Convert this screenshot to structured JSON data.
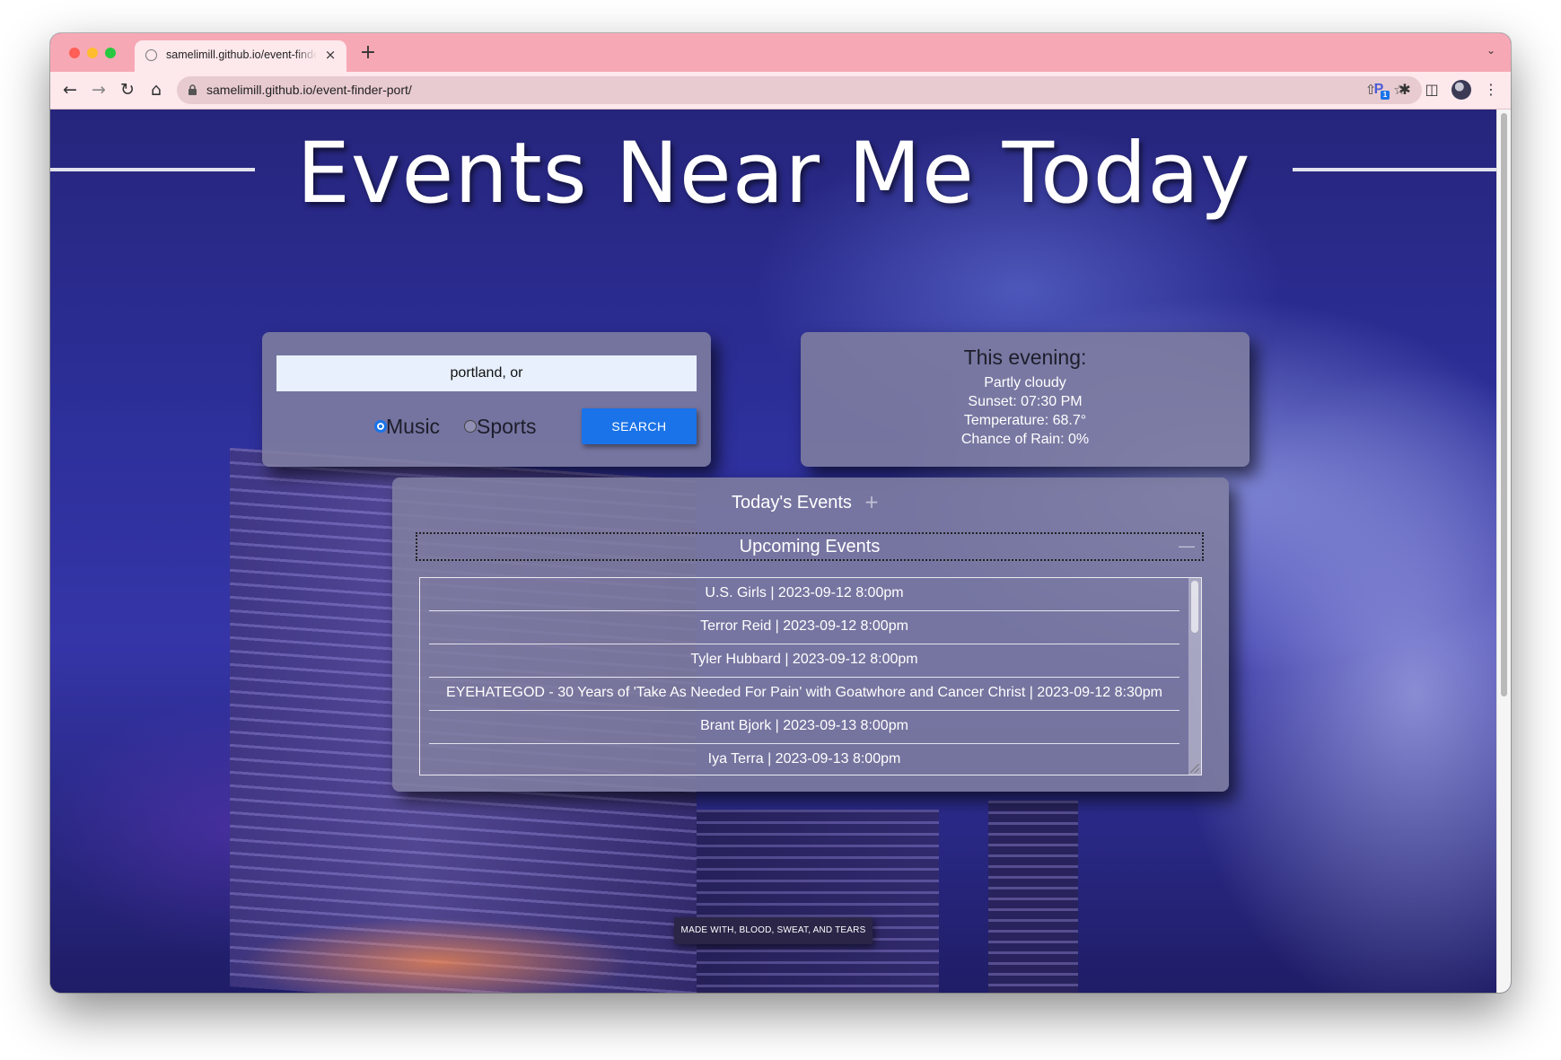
{
  "browser": {
    "tab_title": "samelimill.github.io/event-finder-port/",
    "tab_close": "×",
    "new_tab": "+",
    "url": "samelimill.github.io/event-finder-port/",
    "extension_badge": "1"
  },
  "page": {
    "title": "Events Near Me Today"
  },
  "search": {
    "input_value": "portland, or",
    "options": [
      {
        "label": "Music",
        "checked": true
      },
      {
        "label": "Sports",
        "checked": false
      }
    ],
    "button_label": "SEARCH"
  },
  "weather": {
    "heading": "This evening:",
    "lines": [
      "Partly cloudy",
      "Sunset: 07:30 PM",
      "Temperature: 68.7°",
      "Chance of Rain: 0%"
    ]
  },
  "events": {
    "tabs": [
      {
        "label": "Today's Events",
        "toggle": "+"
      },
      {
        "label": "Upcoming Events",
        "toggle": "—"
      }
    ],
    "items": [
      "U.S. Girls | 2023-09-12 8:00pm",
      "Terror Reid | 2023-09-12 8:00pm",
      "Tyler Hubbard | 2023-09-12 8:00pm",
      "EYEHATEGOD - 30 Years of 'Take As Needed For Pain' with Goatwhore and Cancer Christ | 2023-09-12 8:30pm",
      "Brant Bjork | 2023-09-13 8:00pm",
      "Iya Terra | 2023-09-13 8:00pm"
    ]
  },
  "footer": {
    "text": "MADE WITH, BLOOD, SWEAT, AND TEARS"
  }
}
